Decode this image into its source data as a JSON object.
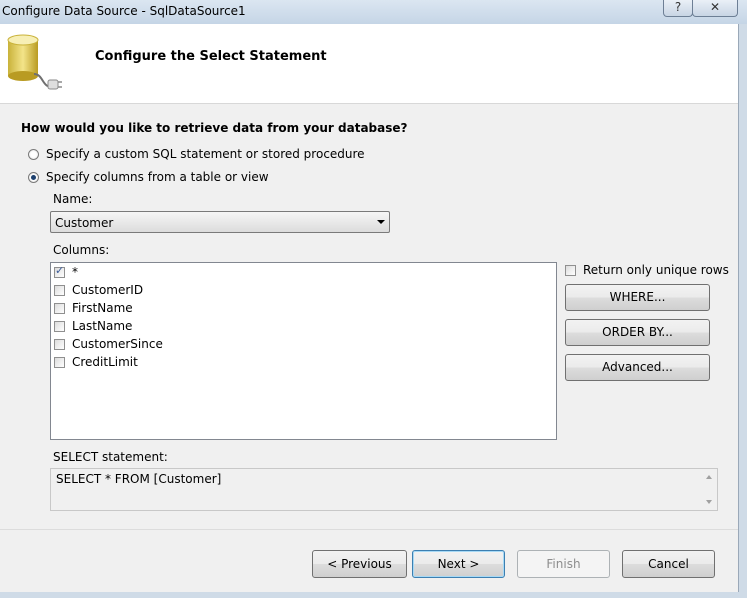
{
  "window": {
    "title": "Configure Data Source - SqlDataSource1",
    "help_label": "?",
    "close_label": "✕"
  },
  "header": {
    "title": "Configure the Select Statement",
    "icon": "database-connection-icon"
  },
  "question": "How would you like to retrieve data from your database?",
  "options": {
    "custom_sql": {
      "label": "Specify a custom SQL statement or stored procedure",
      "selected": false
    },
    "columns": {
      "label": "Specify columns from a table or view",
      "selected": true
    }
  },
  "name_field": {
    "label": "Name:",
    "value": "Customer"
  },
  "columns": {
    "label": "Columns:",
    "items": [
      {
        "label": "*",
        "checked": true
      },
      {
        "label": "CustomerID",
        "checked": false
      },
      {
        "label": "FirstName",
        "checked": false
      },
      {
        "label": "LastName",
        "checked": false
      },
      {
        "label": "CustomerSince",
        "checked": false
      },
      {
        "label": "CreditLimit",
        "checked": false
      }
    ]
  },
  "side": {
    "unique_label": "Return only unique rows",
    "where_label": "WHERE...",
    "orderby_label": "ORDER BY...",
    "advanced_label": "Advanced..."
  },
  "statement": {
    "label": "SELECT statement:",
    "value": "SELECT * FROM [Customer]"
  },
  "footer": {
    "previous_label": "< Previous",
    "next_label": "Next >",
    "finish_label": "Finish",
    "cancel_label": "Cancel"
  }
}
